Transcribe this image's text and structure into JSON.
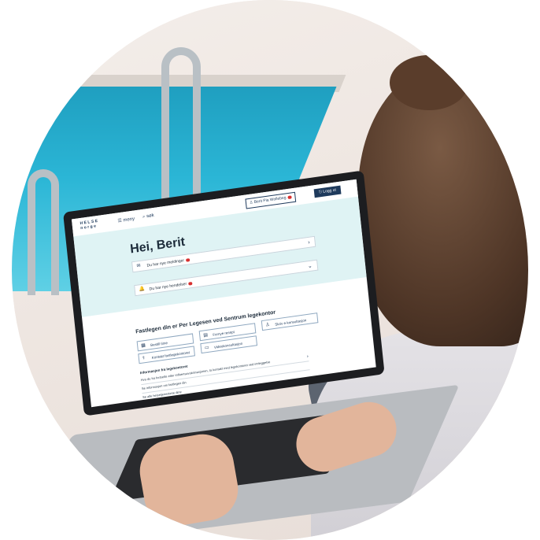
{
  "colors": {
    "brand_dark": "#1e3a5c",
    "screen_top_bg": "#dff3f4",
    "notification_dot": "#d72f2f",
    "pool_water": "#2bb6d6"
  },
  "screen": {
    "logo": {
      "line1": "HELSE",
      "line2": "norge"
    },
    "header": {
      "menu_icon": "hamburger-icon",
      "menu_label": "meny",
      "search_icon": "search-icon",
      "search_label": "søk",
      "user_label": "Berit Pia Wollebeg",
      "logout_label": "Logg ut"
    },
    "greeting": "Hei, Berit",
    "messages": [
      {
        "icon": "mail-icon",
        "label": "Du har nye meldinger"
      },
      {
        "icon": "bell-icon",
        "label": "Du har nye hendelser"
      }
    ],
    "gp_section": {
      "title": "Fastlegen din er Per Legesen ved Sentrum legekontor",
      "buttons": [
        {
          "icon": "calendar-icon",
          "label": "Bestill time"
        },
        {
          "icon": "prescription-icon",
          "label": "Fornye resept"
        },
        {
          "icon": "person-icon",
          "label": "Skriv e-konsultasjon"
        },
        {
          "icon": "doctor-icon",
          "label": "Kontakt fastlegekontoret"
        },
        {
          "icon": "video-icon",
          "label": "Videokonsultasjon"
        }
      ]
    },
    "info": {
      "title": "Informasjon fra legekontoret",
      "rows": [
        "Hva du fra fortsette etter influensavaksinasjonen, ta kontakt med legekontoret ved innleggelse",
        "Se informasjon om fastlegen din",
        "Se alle helsetjenestene dine"
      ]
    }
  }
}
